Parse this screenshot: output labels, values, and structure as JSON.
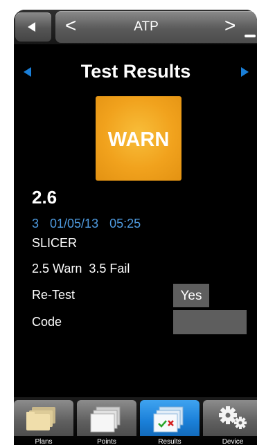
{
  "header": {
    "back_icon": "back-triangle-icon",
    "prev_icon": "chevron-left-icon",
    "next_icon": "chevron-right-icon",
    "title": "ATP",
    "prev_glyph": "<",
    "next_glyph": ">"
  },
  "page": {
    "title": "Test Results",
    "prev_icon": "arrow-left-icon",
    "next_icon": "arrow-right-icon",
    "accent_color": "#1a7fd8"
  },
  "result": {
    "status": "WARN",
    "status_color": "#f1a21d",
    "value": "2.6",
    "index": "3",
    "date": "01/05/13",
    "time": "05:25",
    "point_name": "SLICER",
    "warn_limit": "2.5 Warn",
    "fail_limit": "3.5 Fail",
    "meta_color": "#4f9be0"
  },
  "form": {
    "retest_label": "Re-Test",
    "retest_value": "Yes",
    "code_label": "Code",
    "code_value": ""
  },
  "tabs": [
    {
      "label": "Plans",
      "icon": "folders-icon",
      "active": false
    },
    {
      "label": "Points",
      "icon": "pages-icon",
      "active": false
    },
    {
      "label": "Results",
      "icon": "results-check-icon",
      "active": true
    },
    {
      "label": "Device",
      "icon": "gears-icon",
      "active": false
    }
  ]
}
